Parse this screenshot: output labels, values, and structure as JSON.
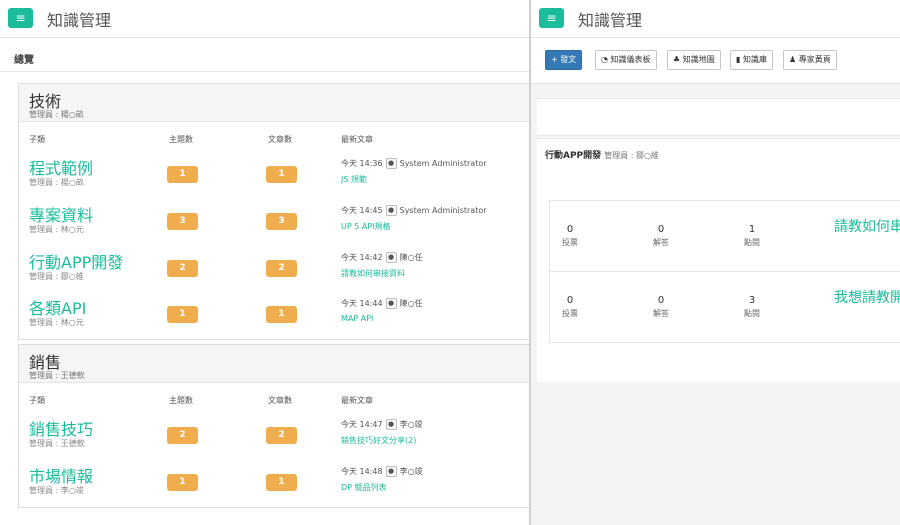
{
  "left": {
    "app_title": "知識管理",
    "menu_icon": "≡",
    "overview_label": "總覽",
    "columns": {
      "sub": "子類",
      "topics": "主題數",
      "articles": "文章數",
      "latest": "最新文章"
    },
    "categories": [
      {
        "name": "技術",
        "admin": "管理員 : 楊○畝",
        "rows": [
          {
            "name": "程式範例",
            "admin": "管理員 : 楊○畝",
            "topics": "1",
            "articles": "1",
            "time": "今天 14:36",
            "user": "System Administrator",
            "link": "JS 規範"
          },
          {
            "name": "專案資料",
            "admin": "管理員 : 林○元",
            "topics": "3",
            "articles": "3",
            "time": "今天 14:45",
            "user": "System Administrator",
            "link": "UP 5 API規格"
          },
          {
            "name": "行動APP開發",
            "admin": "管理員 : 鄒○維",
            "topics": "2",
            "articles": "2",
            "time": "今天 14:42",
            "user": "陳○任",
            "link": "請教如何串接資料"
          },
          {
            "name": "各類API",
            "admin": "管理員 : 林○元",
            "topics": "1",
            "articles": "1",
            "time": "今天 14:44",
            "user": "陳○任",
            "link": "MAP API"
          }
        ]
      },
      {
        "name": "銷售",
        "admin": "管理員 : 王德軟",
        "rows": [
          {
            "name": "銷售技巧",
            "admin": "管理員 : 王德軟",
            "topics": "2",
            "articles": "2",
            "time": "今天 14:47",
            "user": "李○竣",
            "link": "銷售技巧好文分享(2)"
          },
          {
            "name": "市場情報",
            "admin": "管理員 : 李○竣",
            "topics": "1",
            "articles": "1",
            "time": "今天 14:48",
            "user": "李○竣",
            "link": "DP 競品列表"
          }
        ]
      }
    ]
  },
  "right": {
    "app_title": "知識管理",
    "toolbar": {
      "post": "+ 發文",
      "dashboard": "知識儀表板",
      "map": "知識地圖",
      "vault": "知識庫",
      "experts": "專家黃頁"
    },
    "topic": {
      "title": "行動APP開發",
      "admin": "管理員 : 鄒○維"
    },
    "questions": [
      {
        "votes": "0",
        "votes_label": "投票",
        "answers": "0",
        "answers_label": "解答",
        "views": "1",
        "views_label": "點閱",
        "title": "請教如何串"
      },
      {
        "votes": "0",
        "votes_label": "投票",
        "answers": "0",
        "answers_label": "解答",
        "views": "3",
        "views_label": "點閱",
        "title": "我想請教開"
      }
    ]
  },
  "colors": {
    "accent": "#1abc9c",
    "badge": "#f0ad4e",
    "primary": "#337ab7"
  }
}
